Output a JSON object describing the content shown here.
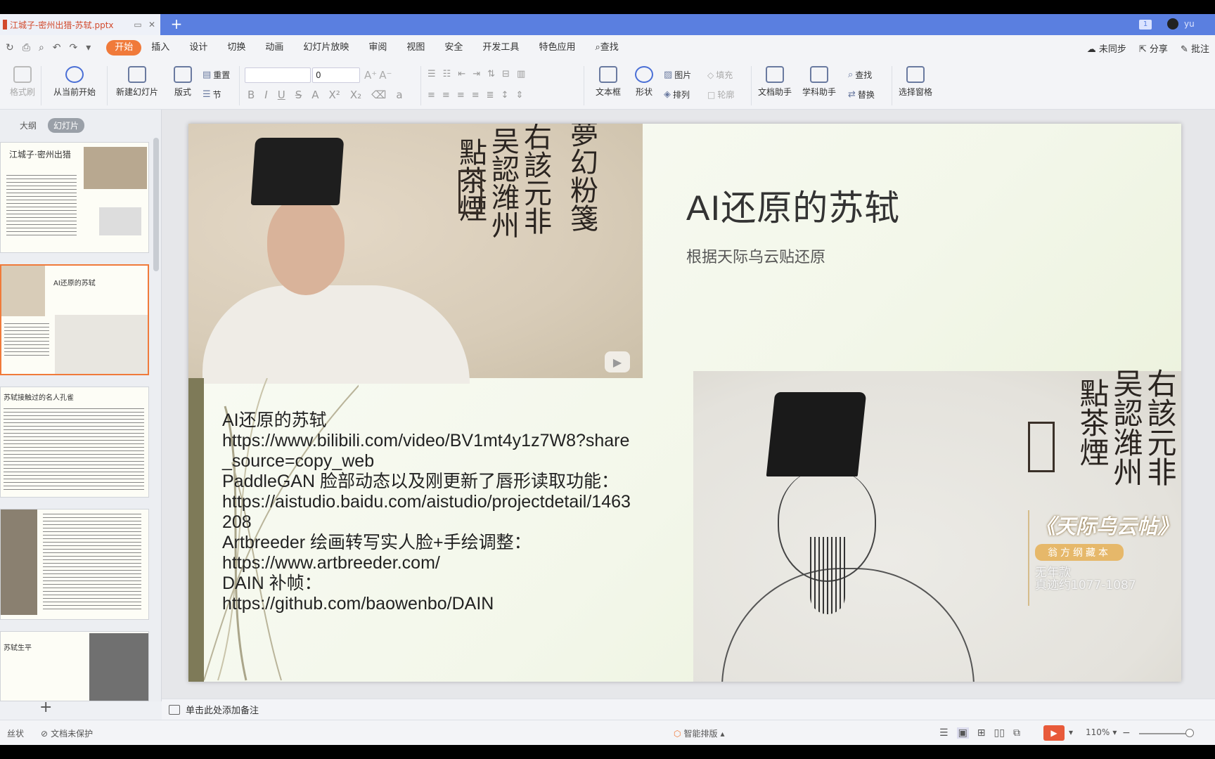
{
  "window": {
    "tab_title": "江城子-密州出猎-苏轼.pptx",
    "badge": "1",
    "user": "yu",
    "new_tab": "+"
  },
  "menu": {
    "items": [
      "开始",
      "插入",
      "设计",
      "切换",
      "动画",
      "幻灯片放映",
      "审阅",
      "视图",
      "安全",
      "开发工具",
      "特色应用",
      "查找"
    ],
    "right": [
      "未同步",
      "分享",
      "批注"
    ]
  },
  "ribbon": {
    "format_painter": "格式刷",
    "start_from_current": "从当前开始",
    "new_slide": "新建幻灯片",
    "layout": "版式",
    "reset": "重置",
    "section": "节",
    "font_size": "0",
    "textbox": "文本框",
    "shape": "形状",
    "picture": "图片",
    "arrange": "排列",
    "fill": "填充",
    "outline": "轮廓",
    "doc_helper": "文档助手",
    "subject_helper": "学科助手",
    "find": "查找",
    "replace": "替换",
    "selection_pane": "选择窗格"
  },
  "panel": {
    "tabs": [
      "大纲",
      "幻灯片"
    ],
    "thumb1_title": "江城子·密州出猎",
    "thumb2_title": "AI还原的苏轼",
    "thumb3_title": "苏轼接触过的名人孔雀",
    "thumb5_title": "苏轼生平",
    "add": "+"
  },
  "slide": {
    "title": "AI还原的苏轼",
    "subtitle": "根据天际乌云贴还原",
    "body": "AI还原的苏轼\nhttps://www.bilibili.com/video/BV1mt4y1z7W8?share_source=copy_web\nPaddleGAN 脸部动态以及刚更新了唇形读取功能：\nhttps://aistudio.baidu.com/aistudio/projectdetail/1463208\nArtbreeder 绘画转写实人脸+手绘调整：\nhttps://www.artbreeder.com/\nDAIN 补帧：\nhttps://github.com/baowenbo/DAIN",
    "calligraphy": [
      "右該元非",
      "吴認潍州",
      "點茶煙",
      "夢幻粉箋"
    ],
    "overlay_title": "《天际乌云帖》",
    "overlay_tag": "翁方纲藏本",
    "overlay_line1": "无年款",
    "overlay_line2": "真迹约1077-1087"
  },
  "notes": {
    "placeholder": "单击此处添加备注"
  },
  "status": {
    "theme": "丝状",
    "protect": "文档未保护",
    "smart": "智能排版",
    "zoom": "110%"
  }
}
